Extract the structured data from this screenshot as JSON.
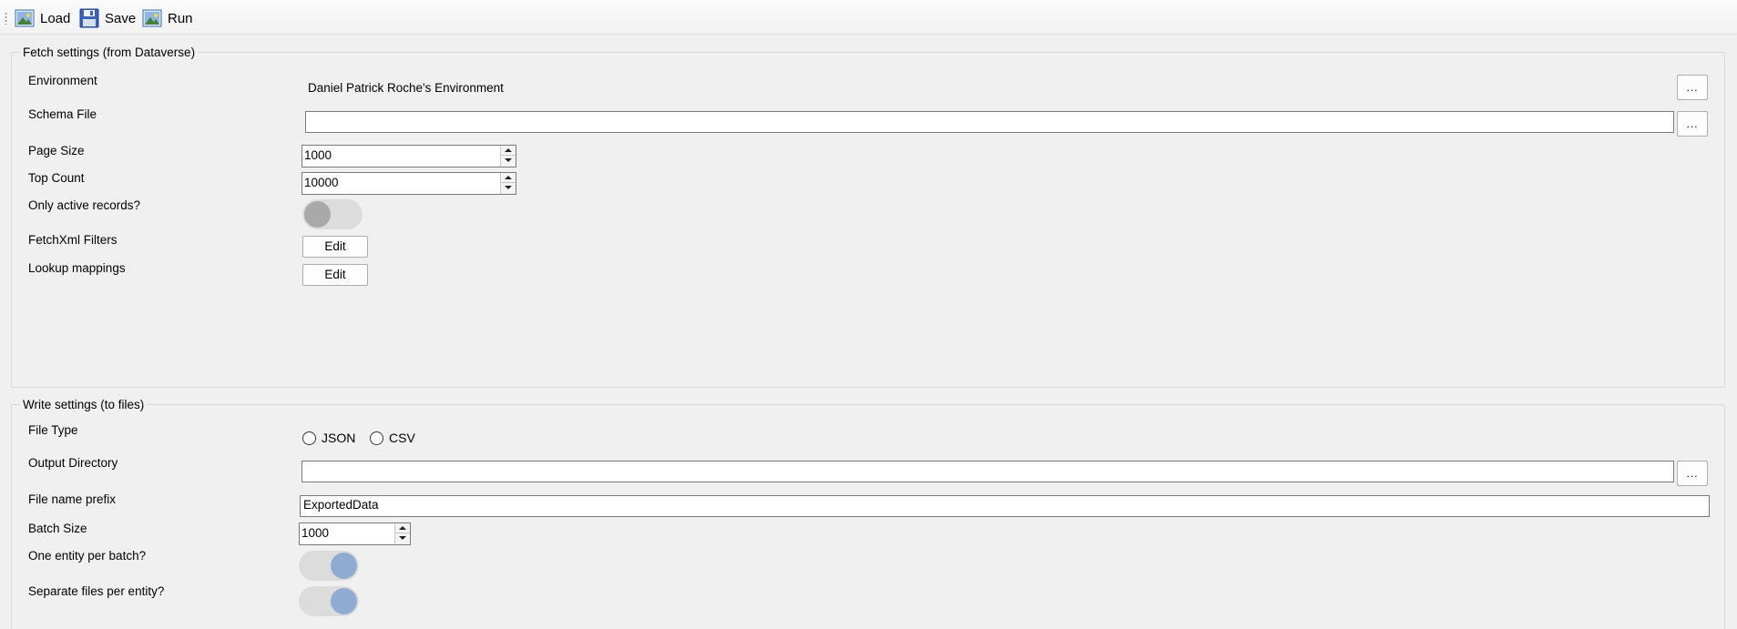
{
  "toolbar": {
    "load_label": "Load",
    "save_label": "Save",
    "run_label": "Run"
  },
  "fetch": {
    "title": "Fetch settings (from Dataverse)",
    "environment_label": "Environment",
    "environment_value": "Daniel Patrick Roche's Environment",
    "schema_file_label": "Schema File",
    "schema_file_value": "",
    "page_size_label": "Page Size",
    "page_size_value": "1000",
    "top_count_label": "Top Count",
    "top_count_value": "10000",
    "only_active_label": "Only active records?",
    "only_active_on": false,
    "fetchxml_label": "FetchXml Filters",
    "fetchxml_button": "Edit",
    "lookup_label": "Lookup mappings",
    "lookup_button": "Edit",
    "browse_button": "..."
  },
  "write": {
    "title": "Write settings (to files)",
    "file_type_label": "File Type",
    "file_type_options": [
      "JSON",
      "CSV"
    ],
    "output_dir_label": "Output Directory",
    "output_dir_value": "",
    "prefix_label": "File name prefix",
    "prefix_value": "ExportedData",
    "batch_size_label": "Batch Size",
    "batch_size_value": "1000",
    "one_entity_label": "One entity per batch?",
    "one_entity_on": true,
    "separate_files_label": "Separate files per entity?",
    "separate_files_on": true,
    "browse_button": "..."
  },
  "colors": {
    "toggle_on_knob": "#8fabd1",
    "toggle_off_knob": "#a9a9a9",
    "toggle_track": "#dcdcdc"
  }
}
